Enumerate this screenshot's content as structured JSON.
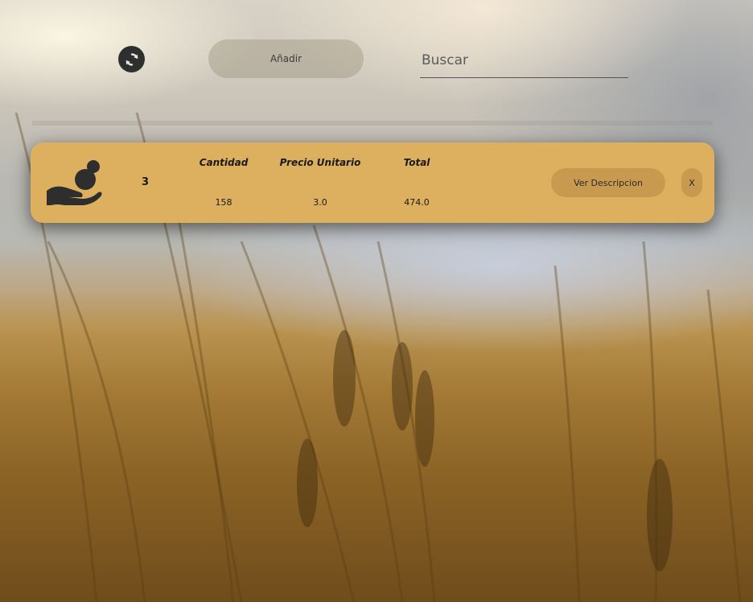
{
  "toolbar": {
    "refresh_icon": "refresh-icon",
    "add_label": "Añadir",
    "search_placeholder": "Buscar",
    "search_value": ""
  },
  "items": [
    {
      "icon": "hand-coin-icon",
      "id": "3",
      "headers": {
        "quantity": "Cantidad",
        "unit_price": "Precio Unitario",
        "total": "Total"
      },
      "values": {
        "quantity": "158",
        "unit_price": "3.0",
        "total": "474.0"
      },
      "description_label": "Ver Descripcion",
      "close_label": "X"
    }
  ],
  "colors": {
    "card_background": "#ddb060",
    "card_button": "#c79a4f",
    "refresh_button": "#2f2f2f"
  }
}
